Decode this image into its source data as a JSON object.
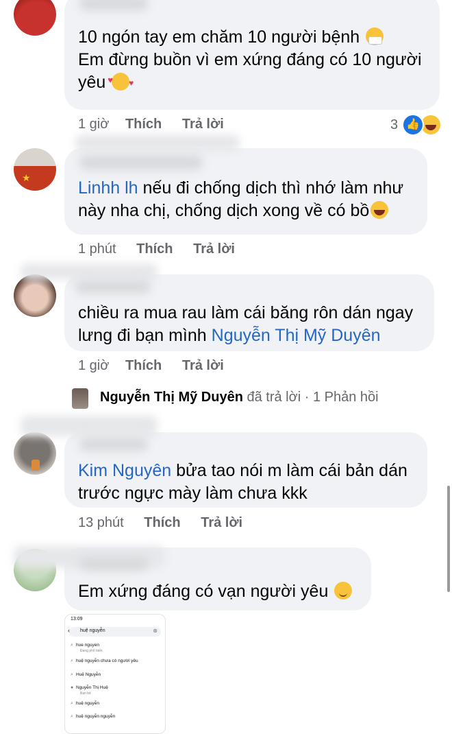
{
  "comments": [
    {
      "text_lines": [
        "10 ngón tay em chăm 10 người bệnh",
        "Em đừng buồn vì em xứng đáng có 10 người",
        "yêu"
      ],
      "time": "1 giờ",
      "like_label": "Thích",
      "reply_label": "Trả lời",
      "reaction_count": "3"
    },
    {
      "mention": "Linhh lh",
      "text_lines": [
        " nếu đi chống dịch thì nhớ làm như",
        "này nha chị, chống dịch xong về có bồ"
      ],
      "time": "1 phút",
      "like_label": "Thích",
      "reply_label": "Trả lời"
    },
    {
      "text_lines": [
        "chiều ra mua rau làm cái băng rôn dán ngay",
        "lưng đi bạn mình "
      ],
      "mention": "Nguyễn Thị Mỹ Duyên",
      "time": "1 giờ",
      "like_label": "Thích",
      "reply_label": "Trả lời",
      "reply_summary": {
        "name": "Nguyễn Thị Mỹ Duyên",
        "action": " đã trả lời · 1 Phản hồi"
      }
    },
    {
      "mention": "Kim Nguyên",
      "text_lines": [
        " bửa tao nói m làm cái bản dán",
        "trước ngực mày làm chưa kkk"
      ],
      "time": "13 phút",
      "like_label": "Thích",
      "reply_label": "Trả lời"
    },
    {
      "text_lines": [
        "Em xứng đáng có vạn người yêu"
      ]
    }
  ],
  "attachment": {
    "time": "13:09",
    "query": "huệ nguyễn",
    "results": [
      {
        "label": "hue nguyen",
        "sub": "Đang phổ biến"
      },
      {
        "label": "huệ nguyễn chưa có người yêu"
      },
      {
        "label": "Huệ Nguyễn"
      },
      {
        "label": "Nguyễn Thị Huệ",
        "sub": "Bạn bè"
      },
      {
        "label": "huệ nguyễn"
      },
      {
        "label": "huệ nguyễn nguyễn"
      }
    ]
  },
  "icons": [
    "like-icon",
    "haha-icon"
  ],
  "colors": {
    "mention": "#2467c4",
    "bubble": "#f0f2f5",
    "meta": "#65676b",
    "like": "#1b74e4"
  }
}
